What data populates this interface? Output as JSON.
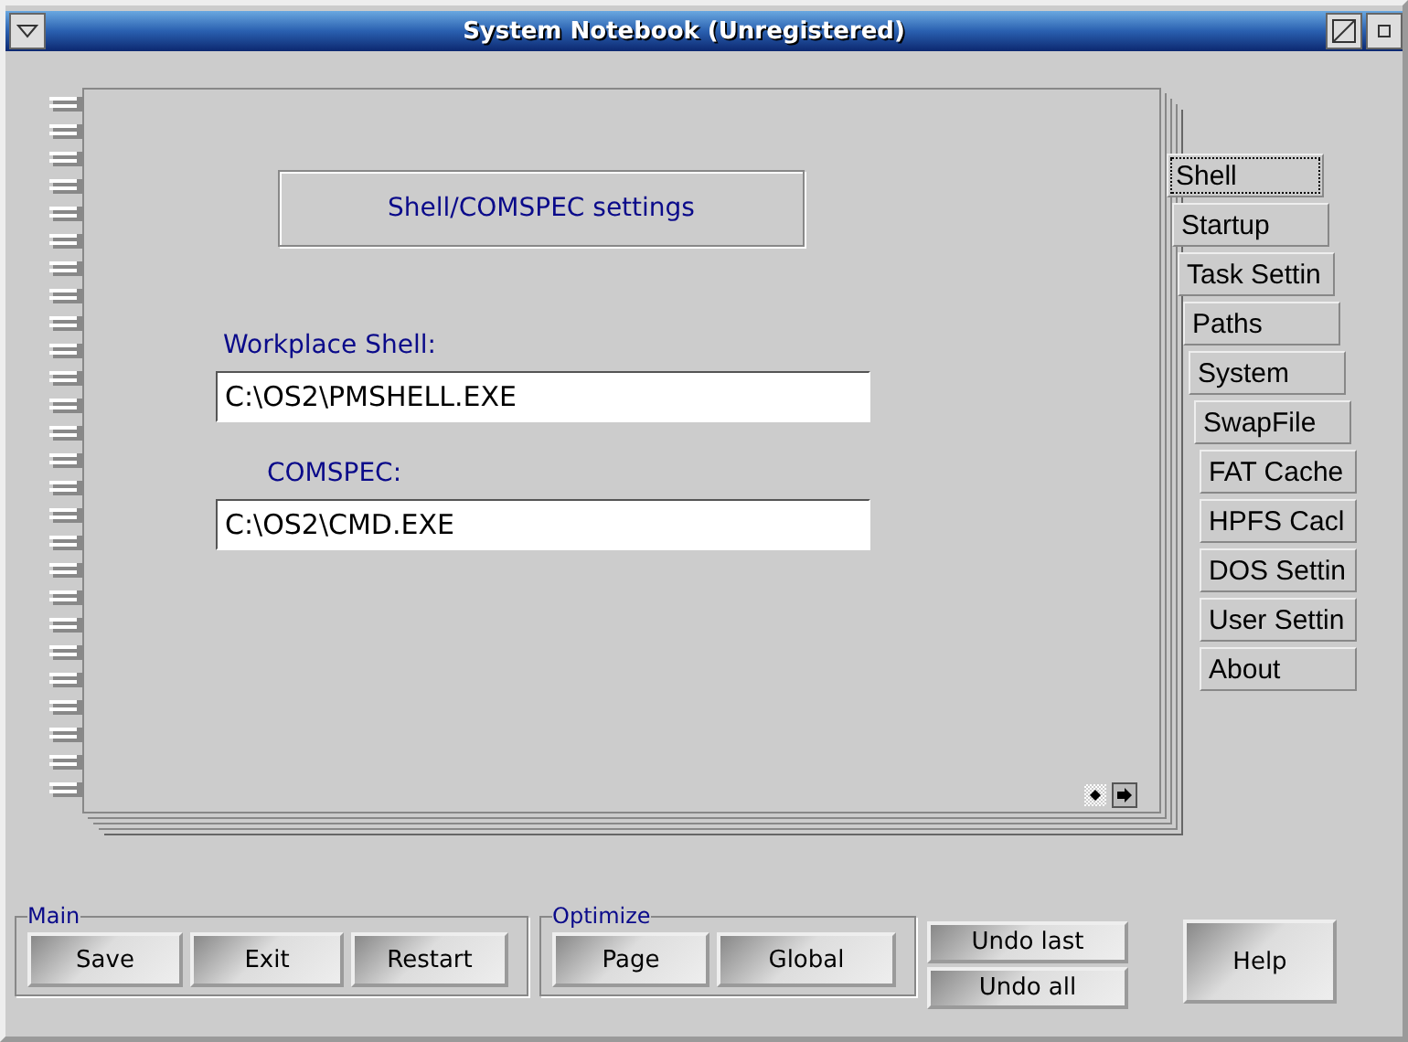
{
  "window": {
    "title": "System Notebook (Unregistered)"
  },
  "page": {
    "heading": "Shell/COMSPEC settings",
    "fields": [
      {
        "label": "Workplace Shell:",
        "value": "C:\\OS2\\PMSHELL.EXE"
      },
      {
        "label": "COMSPEC:",
        "value": "C:\\OS2\\CMD.EXE"
      }
    ]
  },
  "tabs": [
    {
      "label": "Shell",
      "selected": true
    },
    {
      "label": "Startup",
      "selected": false
    },
    {
      "label": "Task Settin",
      "selected": false
    },
    {
      "label": "Paths",
      "selected": false
    },
    {
      "label": "System",
      "selected": false
    },
    {
      "label": "SwapFile",
      "selected": false
    },
    {
      "label": "FAT Cache",
      "selected": false
    },
    {
      "label": "HPFS Cacl",
      "selected": false
    },
    {
      "label": "DOS Settin",
      "selected": false
    },
    {
      "label": "User Settin",
      "selected": false
    },
    {
      "label": "About",
      "selected": false
    }
  ],
  "groups": [
    {
      "title": "Main",
      "buttons": [
        "Save",
        "Exit",
        "Restart"
      ]
    },
    {
      "title": "Optimize",
      "buttons": [
        "Page",
        "Global"
      ]
    }
  ],
  "undo_buttons": [
    "Undo last",
    "Undo all"
  ],
  "help_button": "Help"
}
